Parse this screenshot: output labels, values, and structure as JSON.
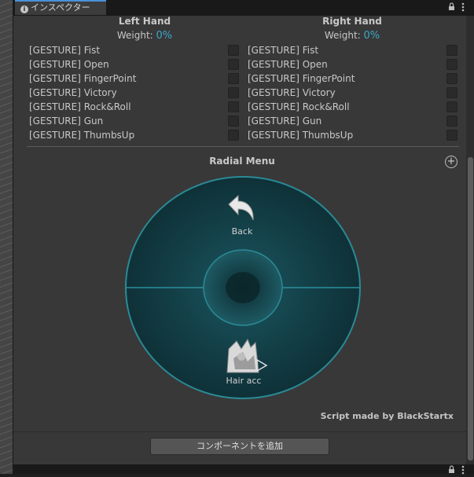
{
  "tab": {
    "label": "インスペクター"
  },
  "left_hand": {
    "title": "Left Hand",
    "weight_label": "Weight:",
    "weight_value": "0%",
    "gestures": [
      "[GESTURE] Fist",
      "[GESTURE] Open",
      "[GESTURE] FingerPoint",
      "[GESTURE] Victory",
      "[GESTURE] Rock&Roll",
      "[GESTURE] Gun",
      "[GESTURE] ThumbsUp"
    ]
  },
  "right_hand": {
    "title": "Right Hand",
    "weight_label": "Weight:",
    "weight_value": "0%",
    "gestures": [
      "[GESTURE] Fist",
      "[GESTURE] Open",
      "[GESTURE] FingerPoint",
      "[GESTURE] Victory",
      "[GESTURE] Rock&Roll",
      "[GESTURE] Gun",
      "[GESTURE] ThumbsUp"
    ]
  },
  "radial_menu": {
    "title": "Radial Menu",
    "top_item": "Back",
    "bottom_item": "Hair acc",
    "ring_color": "#2a8a96",
    "fill_color": "#123f46"
  },
  "credit": "Script made by BlackStartx",
  "add_component_label": "コンポーネントを追加",
  "icons": [
    "info-icon",
    "lock-icon",
    "menu-icon",
    "add-circle-icon",
    "back-arrow-icon",
    "hair-acc-icon"
  ]
}
